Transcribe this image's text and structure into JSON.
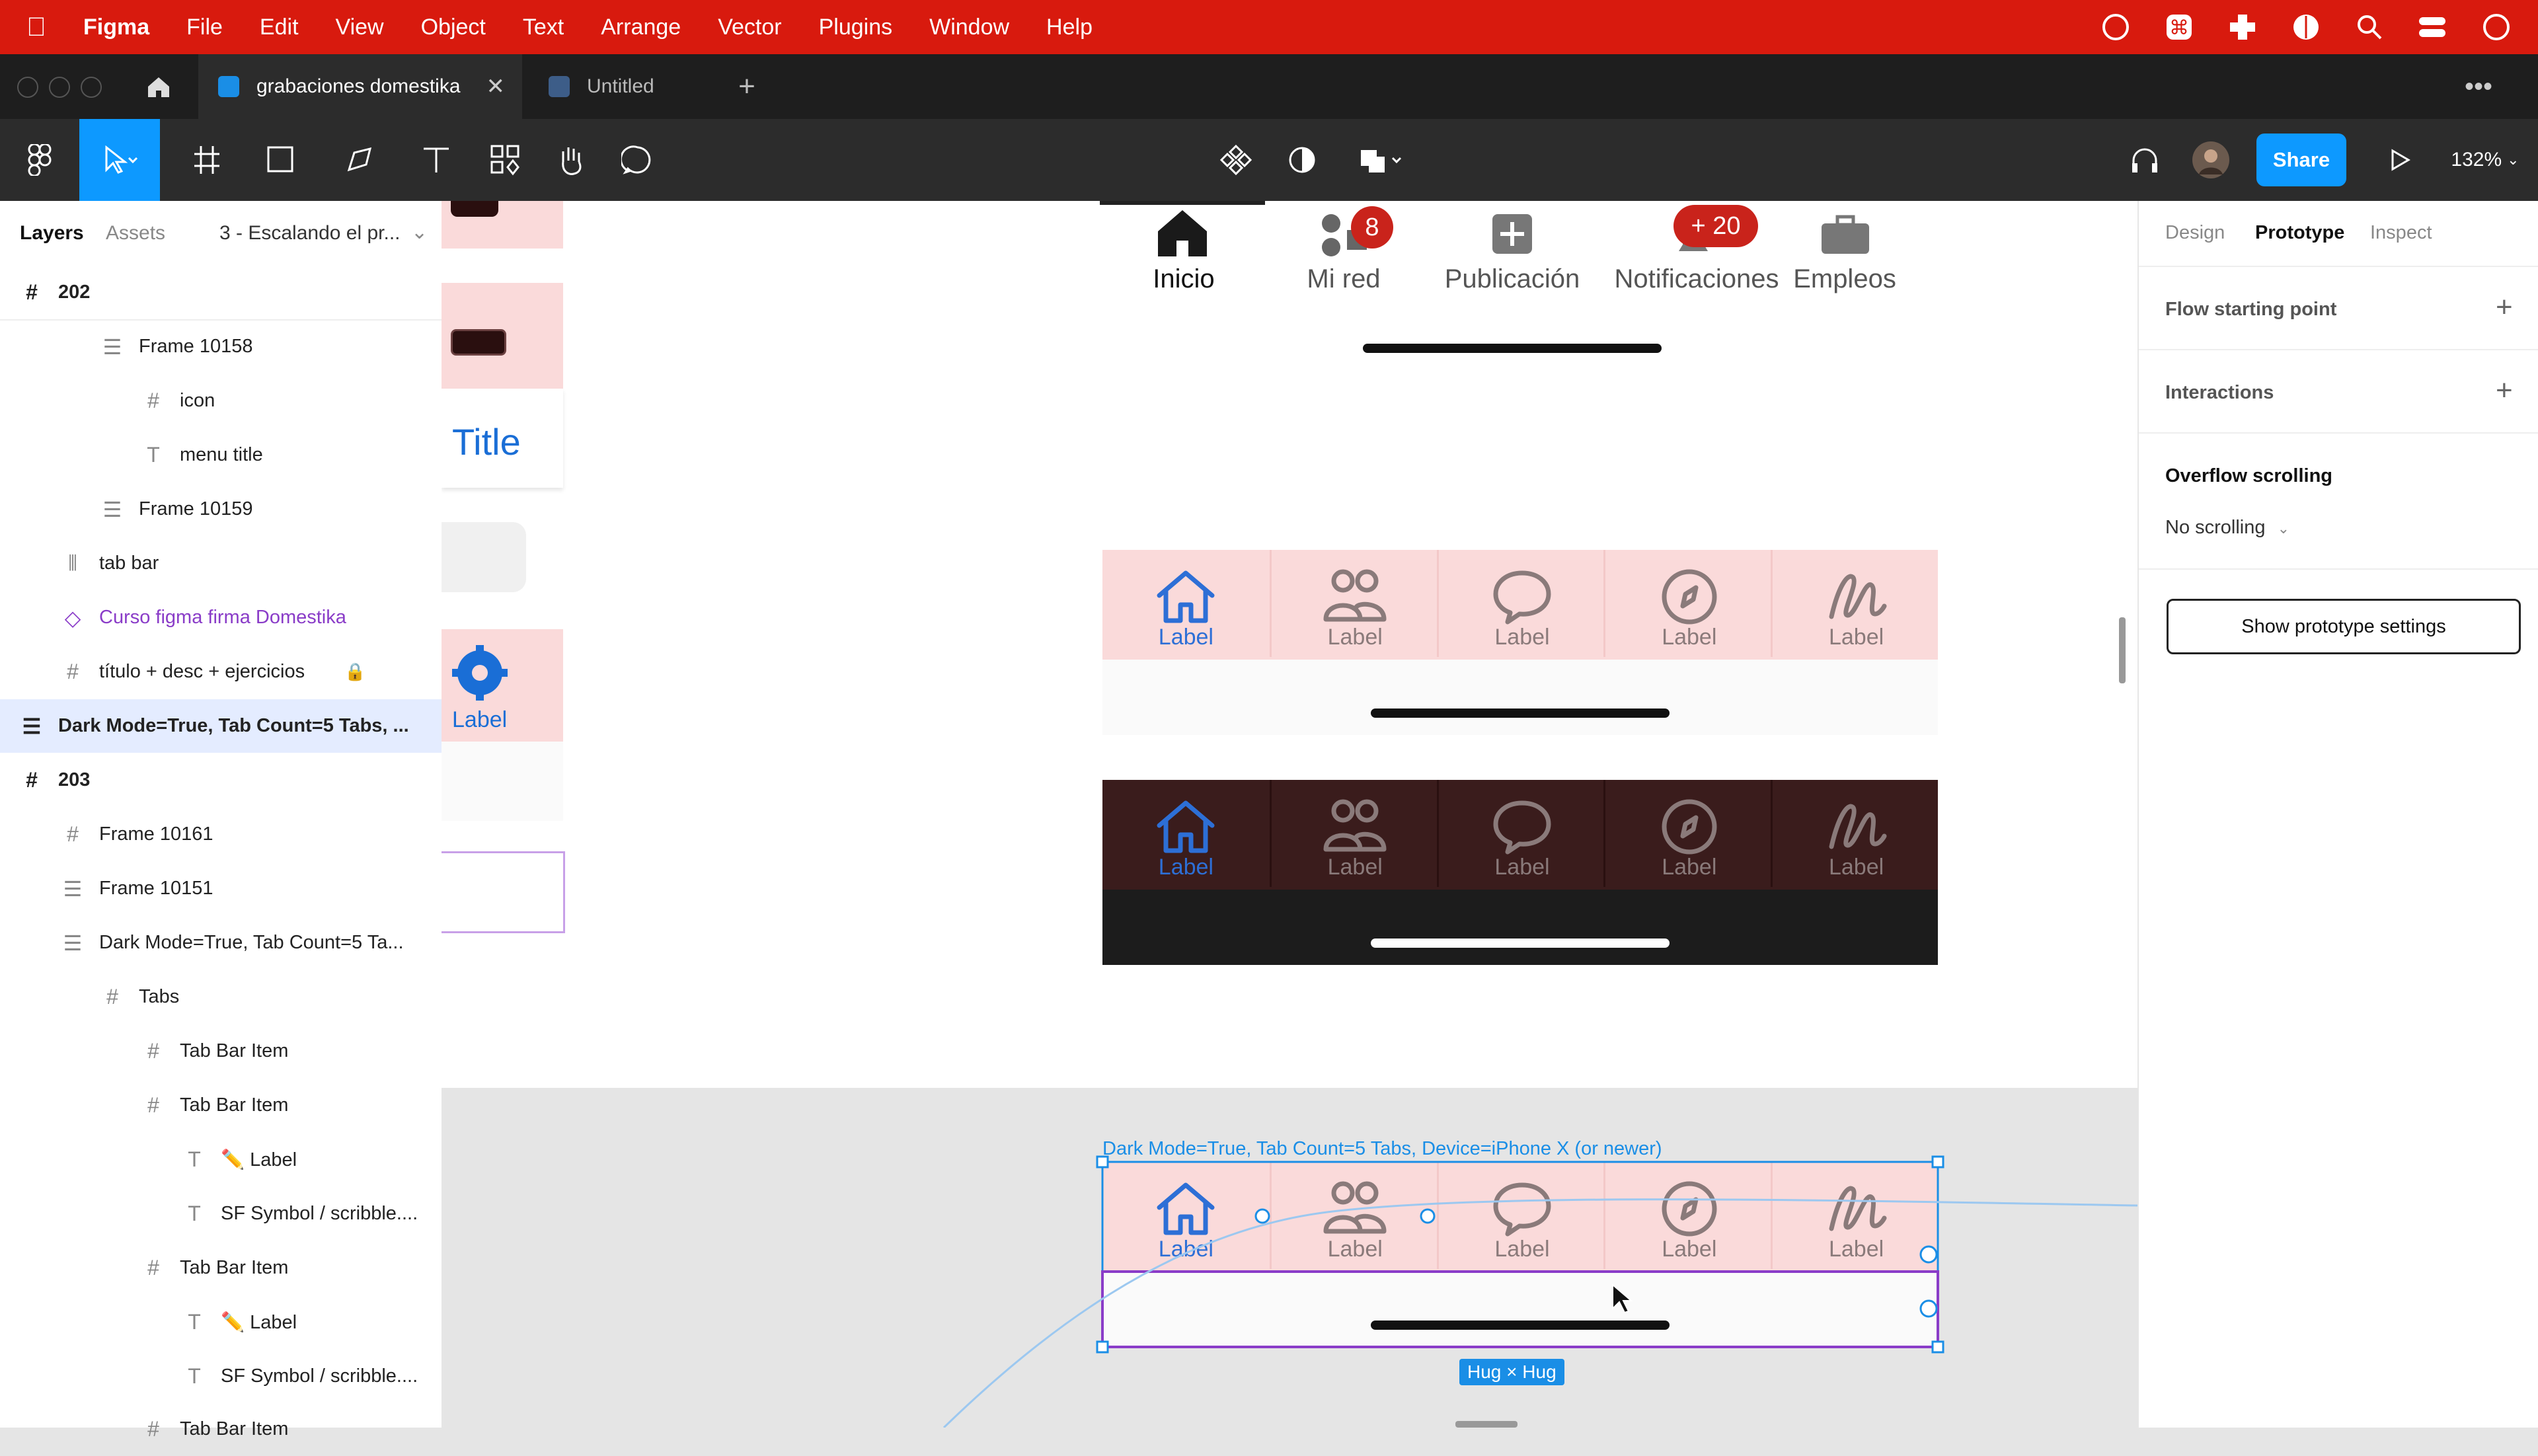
{
  "menubar": {
    "app": "Figma",
    "items": [
      "File",
      "Edit",
      "View",
      "Object",
      "Text",
      "Arrange",
      "Vector",
      "Plugins",
      "Window",
      "Help"
    ]
  },
  "tabs": [
    {
      "label": "grabaciones domestika"
    },
    {
      "label": "Untitled"
    }
  ],
  "toolbar": {
    "share_label": "Share",
    "zoom": "132%"
  },
  "left_panel": {
    "tab_layers": "Layers",
    "tab_assets": "Assets",
    "page_selector": "3 - Escalando el pr...",
    "layers": [
      {
        "label": "202"
      },
      {
        "label": "Frame 10158"
      },
      {
        "label": "icon"
      },
      {
        "label": "menu title"
      },
      {
        "label": "Frame 10159"
      },
      {
        "label": "tab bar"
      },
      {
        "label": "Curso figma firma Domestika"
      },
      {
        "label": "título + desc + ejercicios"
      },
      {
        "label": "Dark Mode=True, Tab Count=5 Tabs, ..."
      },
      {
        "label": "203"
      },
      {
        "label": "Frame 10161"
      },
      {
        "label": "Frame 10151"
      },
      {
        "label": "Dark Mode=True, Tab Count=5 Ta..."
      },
      {
        "label": "Tabs"
      },
      {
        "label": "Tab Bar Item"
      },
      {
        "label": "Tab Bar Item"
      },
      {
        "label": "✏️ Label"
      },
      {
        "label": "SF Symbol / scribble...."
      },
      {
        "label": "Tab Bar Item"
      },
      {
        "label": "✏️ Label"
      },
      {
        "label": "SF Symbol / scribble...."
      },
      {
        "label": "Tab Bar Item"
      }
    ]
  },
  "right_panel": {
    "tab_design": "Design",
    "tab_prototype": "Prototype",
    "tab_inspect": "Inspect",
    "flow_starting_point": "Flow starting point",
    "interactions": "Interactions",
    "overflow_heading": "Overflow scrolling",
    "overflow_value": "No scrolling",
    "show_settings": "Show prototype settings"
  },
  "canvas": {
    "left_title": "Title",
    "left_label": "Label",
    "linkedin_tabs": [
      {
        "label": "Inicio"
      },
      {
        "label": "Mi red",
        "badge": "8"
      },
      {
        "label": "Publicación"
      },
      {
        "label": "Notificaciones",
        "badge": "+ 20"
      },
      {
        "label": "Empleos"
      }
    ],
    "tab_label": "Label",
    "selected_frame_name": "Dark Mode=True, Tab Count=5 Tabs, Device=iPhone X (or newer)",
    "hug_badge": "Hug × Hug"
  },
  "colors": {
    "figma_red_menubar": "#d81a0e",
    "accent_blue": "#1a8ee6",
    "tab_pink": "#fadada",
    "dark_tab_bg": "#3a1c1c",
    "active_blue": "#2d6fd6",
    "inactive_tab": "#8a7a7a"
  }
}
